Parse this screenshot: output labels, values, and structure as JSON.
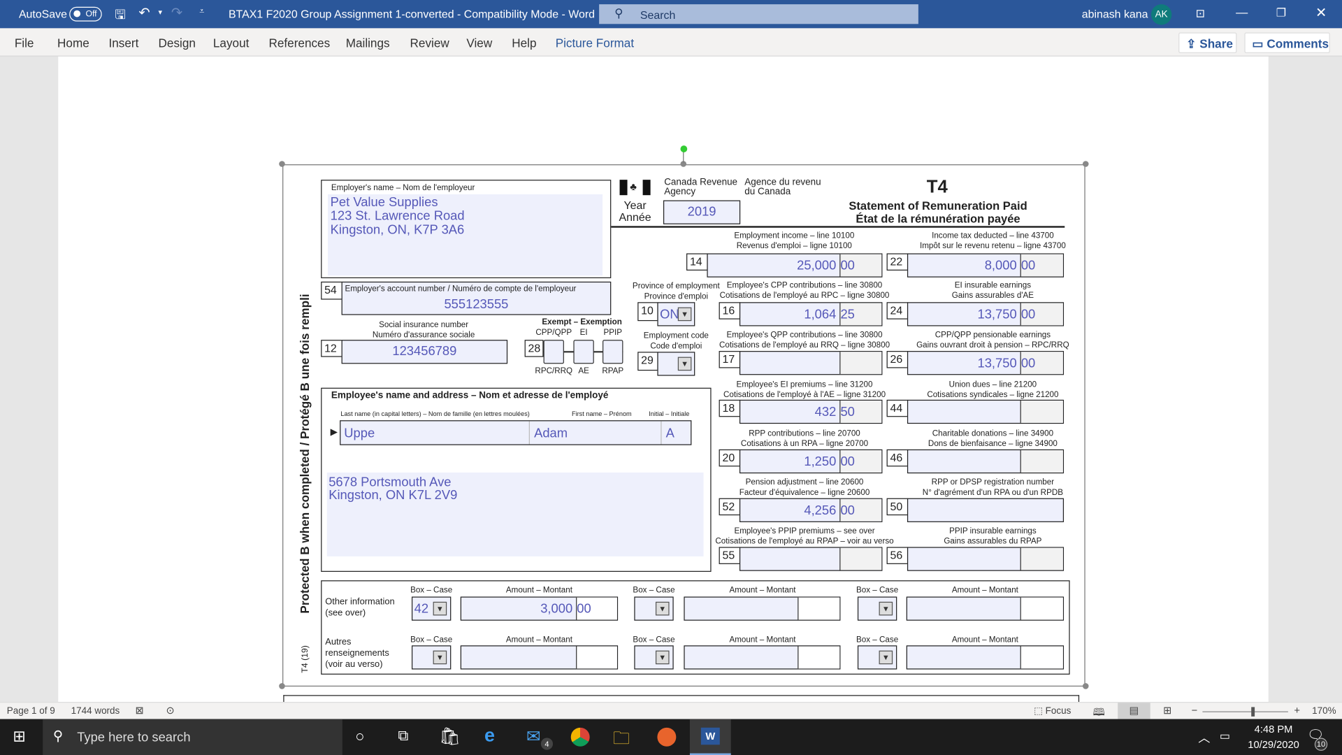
{
  "titlebar": {
    "autosave_label": "AutoSave",
    "autosave_state": "Off",
    "document_title": "BTAX1 F2020 Group Assignment 1-converted  -  Compatibility Mode  -  Word",
    "search_placeholder": "Search",
    "user_name": "abinash kana",
    "user_initials": "AK"
  },
  "ribbon": {
    "tabs": [
      "File",
      "Home",
      "Insert",
      "Design",
      "Layout",
      "References",
      "Mailings",
      "Review",
      "View",
      "Help",
      "Picture Format"
    ],
    "active_tab": "Picture Format",
    "share_label": "Share",
    "comments_label": "Comments"
  },
  "form": {
    "employer_label": "Employer's name – Nom de l'employeur",
    "employer_lines": [
      "Pet Value Supplies",
      "123 St. Lawrence Road",
      "Kingston, ON, K7P 3A6"
    ],
    "agency_en": [
      "Canada Revenue",
      "Agency"
    ],
    "agency_fr": [
      "Agence du revenu",
      "du Canada"
    ],
    "year_label": [
      "Year",
      "Année"
    ],
    "year": "2019",
    "form_code": "T4",
    "title_en": "Statement of Remuneration Paid",
    "title_fr": "État de la rémunération payée",
    "box54": {
      "num": "54",
      "label": "Employer's account number / Numéro de compte de l'employeur",
      "value": "555123555"
    },
    "box12": {
      "num": "12",
      "label": [
        "Social insurance number",
        "Numéro d'assurance sociale"
      ],
      "value": "123456789"
    },
    "box28": {
      "num": "28",
      "label": "Exempt – Exemption",
      "cols_top": [
        "CPP/QPP",
        "EI",
        "PPIP"
      ],
      "cols_bottom": [
        "RPC/RRQ",
        "AE",
        "RPAP"
      ]
    },
    "box10": {
      "num": "10",
      "label": [
        "Province of employment",
        "Province d'emploi"
      ],
      "value": "ON"
    },
    "box29": {
      "num": "29",
      "label": [
        "Employment code",
        "Code d'emploi"
      ],
      "value": ""
    },
    "employee_title": "Employee's name and address – Nom et adresse de l'employé",
    "employee_sublabels": [
      "Last name (in capital letters) – Nom de famille (en lettres moulées)",
      "First name – Prénom",
      "Initial – Initiale"
    ],
    "employee_last": "Uppe",
    "employee_first": "Adam",
    "employee_initial": "A",
    "employee_address": [
      "5678 Portsmouth Ave",
      "Kingston, ON K7L 2V9"
    ],
    "side_text": "Protected B when completed / Protégé B une fois rempli",
    "form_version": "T4 (19)",
    "amount_boxes": [
      {
        "num": "14",
        "label": [
          "Employment income – line 10100",
          "Revenus d'emploi – ligne 10100"
        ],
        "dollars": "25,000",
        "cents": "00"
      },
      {
        "num": "22",
        "label": [
          "Income tax deducted – line 43700",
          "Impôt sur le revenu retenu – ligne 43700"
        ],
        "dollars": "8,000",
        "cents": "00"
      },
      {
        "num": "16",
        "label": [
          "Employee's CPP contributions – line 30800",
          "Cotisations de l'employé au RPC – ligne 30800"
        ],
        "dollars": "1,064",
        "cents": "25"
      },
      {
        "num": "24",
        "label": [
          "EI insurable earnings",
          "Gains assurables d'AE"
        ],
        "dollars": "13,750",
        "cents": "00"
      },
      {
        "num": "17",
        "label": [
          "Employee's QPP contributions – line 30800",
          "Cotisations de l'employé au RRQ – ligne 30800"
        ],
        "dollars": "",
        "cents": ""
      },
      {
        "num": "26",
        "label": [
          "CPP/QPP pensionable earnings",
          "Gains ouvrant droit à pension – RPC/RRQ"
        ],
        "dollars": "13,750",
        "cents": "00"
      },
      {
        "num": "18",
        "label": [
          "Employee's EI premiums – line 31200",
          "Cotisations de l'employé à l'AE – ligne 31200"
        ],
        "dollars": "432",
        "cents": "50"
      },
      {
        "num": "44",
        "label": [
          "Union dues – line 21200",
          "Cotisations syndicales – ligne 21200"
        ],
        "dollars": "",
        "cents": ""
      },
      {
        "num": "20",
        "label": [
          "RPP contributions – line 20700",
          "Cotisations à un RPA – ligne 20700"
        ],
        "dollars": "1,250",
        "cents": "00"
      },
      {
        "num": "46",
        "label": [
          "Charitable donations – line 34900",
          "Dons de bienfaisance – ligne 34900"
        ],
        "dollars": "",
        "cents": ""
      },
      {
        "num": "52",
        "label": [
          "Pension adjustment – line 20600",
          "Facteur d'équivalence – ligne 20600"
        ],
        "dollars": "4,256",
        "cents": "00"
      },
      {
        "num": "50",
        "label": [
          "RPP or DPSP registration number",
          "N° d'agrément d'un RPA ou d'un RPDB"
        ],
        "dollars": "",
        "cents": "",
        "nocents": true
      },
      {
        "num": "55",
        "label": [
          "Employee's PPIP premiums – see over",
          "Cotisations de l'employé au RPAP – voir au verso"
        ],
        "dollars": "",
        "cents": ""
      },
      {
        "num": "56",
        "label": [
          "PPIP insurable earnings",
          "Gains assurables du RPAP"
        ],
        "dollars": "",
        "cents": ""
      }
    ],
    "other_info_label": [
      "Other information",
      "(see over)"
    ],
    "other_info_label_fr": [
      "Autres",
      "renseignements",
      "(voir au verso)"
    ],
    "other_box_header": "Box – Case",
    "other_amount_header": "Amount – Montant",
    "other_rows": [
      [
        {
          "box": "42",
          "amount": "3,000",
          "cents": "00"
        },
        {
          "box": "",
          "amount": "",
          "cents": ""
        },
        {
          "box": "",
          "amount": "",
          "cents": ""
        }
      ],
      [
        {
          "box": "",
          "amount": "",
          "cents": ""
        },
        {
          "box": "",
          "amount": "",
          "cents": ""
        },
        {
          "box": "",
          "amount": "",
          "cents": ""
        }
      ]
    ]
  },
  "status": {
    "page": "Page 1 of 9",
    "words": "1744 words",
    "focus_label": "Focus",
    "zoom": "170%",
    "zoom_percent": 170
  },
  "taskbar": {
    "search_placeholder": "Type here to search",
    "mail_badge": "4",
    "time": "4:48 PM",
    "date": "10/29/2020",
    "notifications": "10"
  },
  "colors": {
    "word_blue": "#2b579a",
    "field_fill": "#eef0fc",
    "value_text": "#5558b8",
    "avatar": "#0f7b7b"
  }
}
